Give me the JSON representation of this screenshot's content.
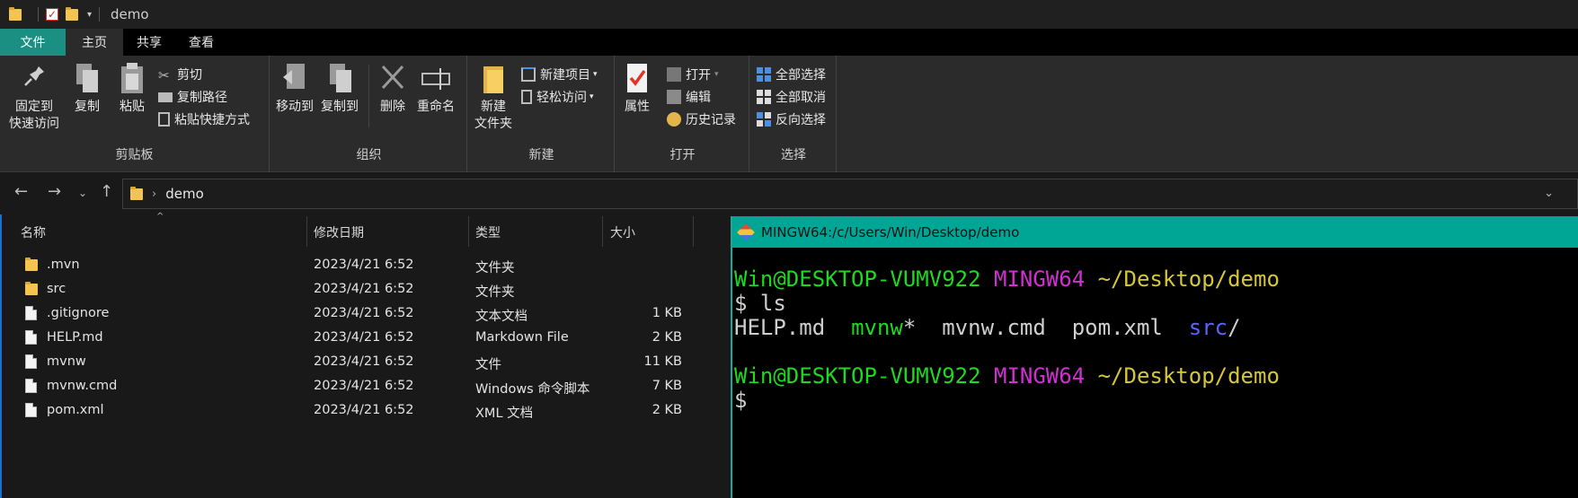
{
  "window": {
    "title": "demo"
  },
  "tabs": [
    "文件",
    "主页",
    "共享",
    "查看"
  ],
  "ribbon": {
    "clipboard": {
      "label": "剪贴板",
      "pin": "固定到\n快速访问",
      "copy": "复制",
      "paste": "粘贴",
      "cut": "剪切",
      "copy_path": "复制路径",
      "paste_shortcut": "粘贴快捷方式"
    },
    "organize": {
      "label": "组织",
      "move_to": "移动到",
      "copy_to": "复制到",
      "delete": "删除",
      "rename": "重命名"
    },
    "new": {
      "label": "新建",
      "new_folder": "新建\n文件夹",
      "new_item": "新建项目",
      "easy_access": "轻松访问"
    },
    "open": {
      "label": "打开",
      "properties": "属性",
      "open": "打开",
      "edit": "编辑",
      "history": "历史记录"
    },
    "select": {
      "label": "选择",
      "select_all": "全部选择",
      "select_none": "全部取消",
      "invert": "反向选择"
    }
  },
  "address": {
    "crumb": "demo"
  },
  "columns": {
    "name": "名称",
    "date": "修改日期",
    "type": "类型",
    "size": "大小"
  },
  "files": [
    {
      "name": ".mvn",
      "date": "2023/4/21 6:52",
      "type": "文件夹",
      "size": "",
      "icon": "folder-icon"
    },
    {
      "name": "src",
      "date": "2023/4/21 6:52",
      "type": "文件夹",
      "size": "",
      "icon": "folder-icon"
    },
    {
      "name": ".gitignore",
      "date": "2023/4/21 6:52",
      "type": "文本文档",
      "size": "1 KB",
      "icon": "text-file-icon"
    },
    {
      "name": "HELP.md",
      "date": "2023/4/21 6:52",
      "type": "Markdown File",
      "size": "2 KB",
      "icon": "markdown-file-icon"
    },
    {
      "name": "mvnw",
      "date": "2023/4/21 6:52",
      "type": "文件",
      "size": "11 KB",
      "icon": "file-icon"
    },
    {
      "name": "mvnw.cmd",
      "date": "2023/4/21 6:52",
      "type": "Windows 命令脚本",
      "size": "7 KB",
      "icon": "script-file-icon"
    },
    {
      "name": "pom.xml",
      "date": "2023/4/21 6:52",
      "type": "XML 文档",
      "size": "2 KB",
      "icon": "file-icon"
    }
  ],
  "terminal": {
    "title": "MINGW64:/c/Users/Win/Desktop/demo",
    "user_host": "Win@DESKTOP-VUMV922",
    "env": "MINGW64",
    "cwd": "~/Desktop/demo",
    "prompt": "$",
    "command": " ls",
    "ls_output": [
      "HELP.md",
      "mvnw",
      "*",
      "mvnw.cmd",
      "pom.xml",
      "src",
      "/"
    ]
  }
}
